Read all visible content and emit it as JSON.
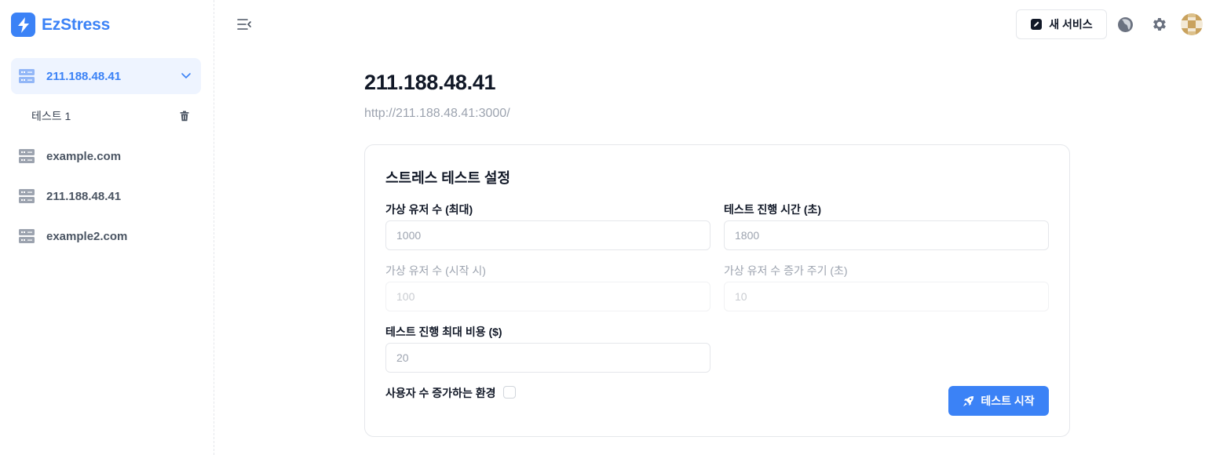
{
  "app": {
    "name": "EzStress"
  },
  "sidebar": {
    "items": [
      {
        "label": "211.188.48.41",
        "active": true,
        "expanded": true,
        "children": [
          {
            "label": "테스트 1"
          }
        ]
      },
      {
        "label": "example.com"
      },
      {
        "label": "211.188.48.41"
      },
      {
        "label": "example2.com"
      }
    ]
  },
  "topbar": {
    "new_service_label": "새 서비스"
  },
  "main": {
    "title": "211.188.48.41",
    "url": "http://211.188.48.41:3000/",
    "card": {
      "title": "스트레스 테스트 설정",
      "fields": {
        "max_users": {
          "label": "가상 유저 수 (최대)",
          "placeholder": "1000"
        },
        "duration": {
          "label": "테스트 진행 시간 (초)",
          "placeholder": "1800"
        },
        "start_users": {
          "label": "가상 유저 수 (시작 시)",
          "placeholder": "100",
          "disabled": true
        },
        "ramp_period": {
          "label": "가상 유저 수 증가 주기 (초)",
          "placeholder": "10",
          "disabled": true
        },
        "max_cost": {
          "label": "테스트 진행 최대 비용 ($)",
          "placeholder": "20"
        }
      },
      "ramp_checkbox_label": "사용자 수 증가하는 환경",
      "ramp_checked": false,
      "start_button_label": "테스트 시작"
    }
  },
  "colors": {
    "accent": "#3b82f6",
    "active_bg": "#eef4ff",
    "muted_text": "#9ca3af"
  }
}
